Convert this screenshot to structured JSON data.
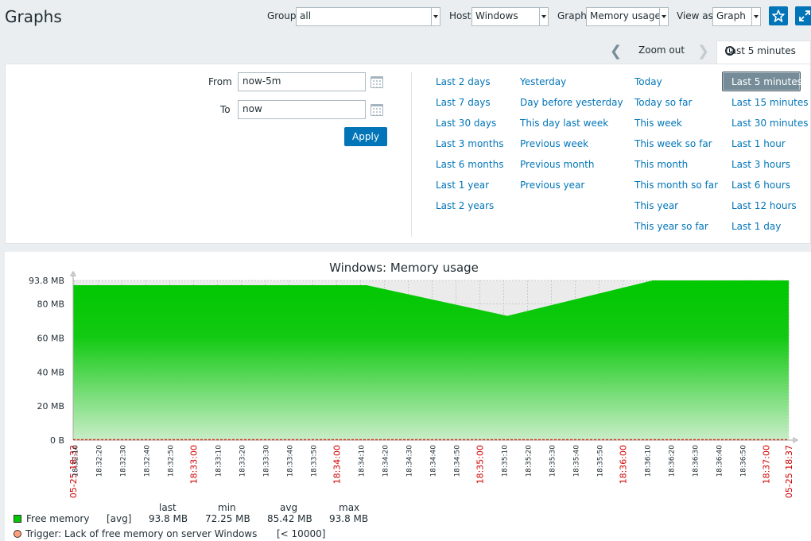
{
  "page": {
    "title": "Graphs",
    "filters": {
      "group_label": "Group",
      "group_value": "all",
      "host_label": "Host",
      "host_value": "Windows",
      "graph_label": "Graph",
      "graph_value": "Memory usage",
      "view_label": "View as",
      "view_value": "Graph"
    },
    "icons": {
      "favourite": "star-icon",
      "fullscreen": "expand-icon"
    }
  },
  "timebar": {
    "zoom_out": "Zoom out",
    "active_tab": "Last 5 minutes",
    "icons": {
      "prev": "chevron-left-icon",
      "next": "chevron-right-icon",
      "clock": "clock-icon"
    }
  },
  "time_filter": {
    "from_label": "From",
    "from_value": "now-5m",
    "to_label": "To",
    "to_value": "now",
    "apply_label": "Apply",
    "selected": "Last 5 minutes",
    "quick_columns": [
      [
        "Last 2 days",
        "Last 7 days",
        "Last 30 days",
        "Last 3 months",
        "Last 6 months",
        "Last 1 year",
        "Last 2 years"
      ],
      [
        "Yesterday",
        "Day before yesterday",
        "This day last week",
        "Previous week",
        "Previous month",
        "Previous year"
      ],
      [
        "Today",
        "Today so far",
        "This week",
        "This week so far",
        "This month",
        "This month so far",
        "This year",
        "This year so far"
      ],
      [
        "Last 5 minutes",
        "Last 15 minutes",
        "Last 30 minutes",
        "Last 1 hour",
        "Last 3 hours",
        "Last 6 hours",
        "Last 12 hours",
        "Last 1 day"
      ]
    ]
  },
  "chart_data": {
    "type": "area",
    "title": "Windows: Memory usage",
    "y_ticks": [
      "0 B",
      "20 MB",
      "40 MB",
      "60 MB",
      "80 MB",
      "93.8 MB"
    ],
    "y_tick_values": [
      0,
      20,
      40,
      60,
      80,
      93.8
    ],
    "ylim": [
      0,
      93.8
    ],
    "x_ticks": [
      {
        "t": "05-25 18:32",
        "s": 0,
        "major": true
      },
      {
        "t": "18:32:10",
        "s": 0.5
      },
      {
        "t": "18:32:20",
        "s": 10.5
      },
      {
        "t": "18:32:30",
        "s": 20.5
      },
      {
        "t": "18:32:40",
        "s": 30.5
      },
      {
        "t": "18:32:50",
        "s": 40.5
      },
      {
        "t": "18:33:00",
        "s": 50.5,
        "major": true
      },
      {
        "t": "18:33:10",
        "s": 60.5
      },
      {
        "t": "18:33:20",
        "s": 70.5
      },
      {
        "t": "18:33:30",
        "s": 80.5
      },
      {
        "t": "18:33:40",
        "s": 90.5
      },
      {
        "t": "18:33:50",
        "s": 100.5
      },
      {
        "t": "18:34:00",
        "s": 110.5,
        "major": true
      },
      {
        "t": "18:34:10",
        "s": 120.5
      },
      {
        "t": "18:34:20",
        "s": 130.5
      },
      {
        "t": "18:34:30",
        "s": 140.5
      },
      {
        "t": "18:34:40",
        "s": 150.5
      },
      {
        "t": "18:34:50",
        "s": 160.5
      },
      {
        "t": "18:35:00",
        "s": 170.5,
        "major": true
      },
      {
        "t": "18:35:10",
        "s": 180.5
      },
      {
        "t": "18:35:20",
        "s": 190.5
      },
      {
        "t": "18:35:30",
        "s": 200.5
      },
      {
        "t": "18:35:40",
        "s": 210.5
      },
      {
        "t": "18:35:50",
        "s": 220.5
      },
      {
        "t": "18:36:00",
        "s": 230.5,
        "major": true
      },
      {
        "t": "18:36:10",
        "s": 240.5
      },
      {
        "t": "18:36:20",
        "s": 250.5
      },
      {
        "t": "18:36:30",
        "s": 260.5
      },
      {
        "t": "18:36:40",
        "s": 270.5
      },
      {
        "t": "18:36:50",
        "s": 280.5
      },
      {
        "t": "18:37:00",
        "s": 290.5,
        "major": true
      },
      {
        "t": "05-25 18:37",
        "s": 300,
        "major": true
      }
    ],
    "x_range_seconds": [
      0,
      300
    ],
    "series": [
      {
        "name": "Free memory",
        "color": "#00c800",
        "points": [
          [
            0,
            91
          ],
          [
            123,
            91
          ],
          [
            182,
            73
          ],
          [
            243,
            93.8
          ],
          [
            300,
            93.8
          ]
        ]
      }
    ],
    "trigger": {
      "name": "Trigger: Lack of free memory on server Windows",
      "threshold": "[< 10000]",
      "color": "#d4321c"
    },
    "grid": true
  },
  "legend": {
    "headers": [
      "last",
      "min",
      "avg",
      "max"
    ],
    "item_name": "Free memory",
    "item_func": "[avg]",
    "values": [
      "93.8 MB",
      "72.25 MB",
      "85.42 MB",
      "93.8 MB"
    ],
    "swatch_color": "#00c800",
    "trigger_text": "Trigger: Lack of free memory on server Windows",
    "trigger_threshold": "[< 10000]",
    "trigger_color": "#ffa07a"
  }
}
